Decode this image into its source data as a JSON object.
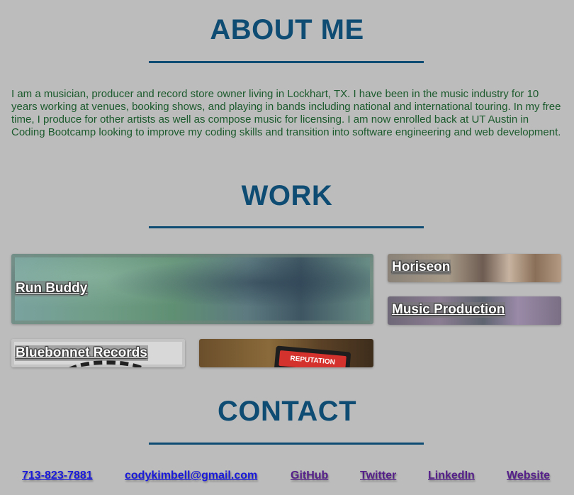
{
  "about": {
    "title": "ABOUT ME",
    "text": "I am a musician, producer and record store owner living in Lockhart, TX. I have been in the music industry for 10 years working at venues, booking shows, and playing in bands including national and international touring. In my free time, I produce for other artists as well as compose music for licensing. I am now enrolled back at UT Austin in Coding Bootcamp looking to improve my coding skills and transition into software engineering and web development."
  },
  "work": {
    "title": "WORK",
    "projects": [
      {
        "label": "Run Buddy"
      },
      {
        "label": "Horiseon"
      },
      {
        "label": "Music Production"
      },
      {
        "label": "Bluebonnet Records"
      },
      {
        "label": "",
        "badge_text": "REPUTATION"
      }
    ]
  },
  "contact": {
    "title": "CONTACT",
    "links": [
      {
        "label": "713-823-7881"
      },
      {
        "label": "codykimbell@gmail.com"
      },
      {
        "label": "GitHub"
      },
      {
        "label": "Twitter"
      },
      {
        "label": "LinkedIn"
      },
      {
        "label": "Website"
      }
    ]
  },
  "colors": {
    "background": "#bcbcbc",
    "heading": "#0f4c73",
    "body_text": "#1b5a2c",
    "link": "#1a1adb",
    "link_visited": "#56208a"
  }
}
